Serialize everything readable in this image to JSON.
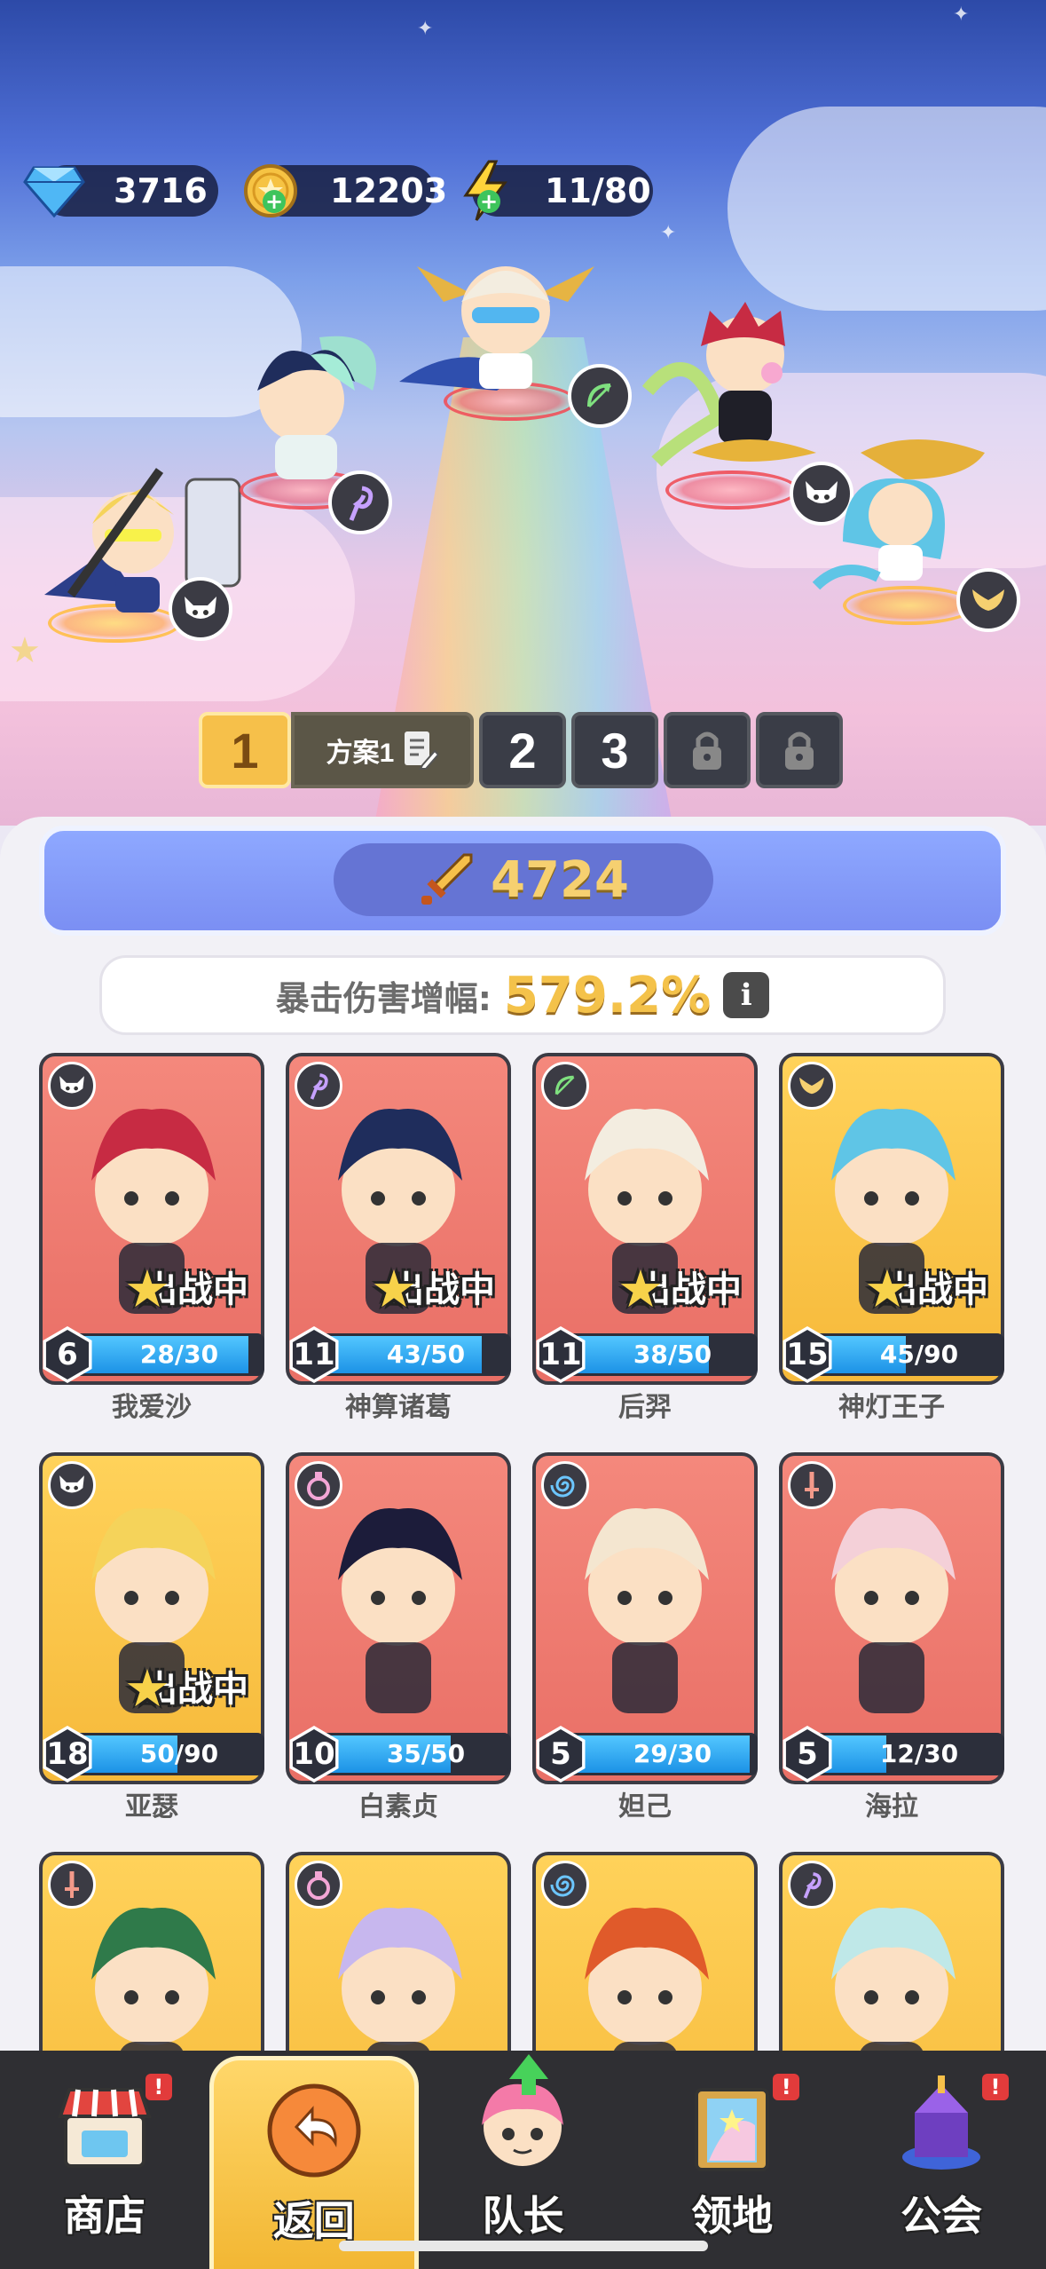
{
  "resources": {
    "diamonds": "3716",
    "gold": "12203",
    "energy": "11/80"
  },
  "formation": {
    "tabs": [
      "1",
      "2",
      "3"
    ],
    "active_tab": "1",
    "plan_label": "方案1"
  },
  "power": {
    "value": "4724"
  },
  "stat": {
    "label": "暴击伤害增幅:",
    "value": "579.2%",
    "info_glyph": "i"
  },
  "deploy_text": "出战中",
  "heroes": [
    {
      "name": "我爱沙",
      "level": "6",
      "exp": "28/30",
      "exp_fraction": 0.93,
      "deployed": true,
      "bg": "red",
      "class_icon": "demon-icon"
    },
    {
      "name": "神算诸葛",
      "level": "11",
      "exp": "43/50",
      "exp_fraction": 0.86,
      "deployed": true,
      "bg": "red",
      "class_icon": "staff-icon"
    },
    {
      "name": "后羿",
      "level": "11",
      "exp": "38/50",
      "exp_fraction": 0.76,
      "deployed": true,
      "bg": "red",
      "class_icon": "bow-icon"
    },
    {
      "name": "神灯王子",
      "level": "15",
      "exp": "45/90",
      "exp_fraction": 0.5,
      "deployed": true,
      "bg": "gold",
      "class_icon": "wings-icon"
    },
    {
      "name": "亚瑟",
      "level": "18",
      "exp": "50/90",
      "exp_fraction": 0.56,
      "deployed": true,
      "bg": "gold",
      "class_icon": "demon-icon"
    },
    {
      "name": "白素贞",
      "level": "10",
      "exp": "35/50",
      "exp_fraction": 0.7,
      "deployed": false,
      "bg": "red",
      "class_icon": "potion-icon"
    },
    {
      "name": "妲己",
      "level": "5",
      "exp": "29/30",
      "exp_fraction": 0.97,
      "deployed": false,
      "bg": "red",
      "class_icon": "swirl-icon"
    },
    {
      "name": "海拉",
      "level": "5",
      "exp": "12/30",
      "exp_fraction": 0.4,
      "deployed": false,
      "bg": "red",
      "class_icon": "sword-icon"
    },
    {
      "name": "",
      "level": "",
      "exp": "",
      "exp_fraction": 0,
      "deployed": false,
      "bg": "gold",
      "class_icon": "sword-icon"
    },
    {
      "name": "",
      "level": "",
      "exp": "",
      "exp_fraction": 0,
      "deployed": false,
      "bg": "gold",
      "class_icon": "potion-icon"
    },
    {
      "name": "",
      "level": "",
      "exp": "",
      "exp_fraction": 0,
      "deployed": false,
      "bg": "gold",
      "class_icon": "swirl-icon"
    },
    {
      "name": "",
      "level": "",
      "exp": "",
      "exp_fraction": 0,
      "deployed": false,
      "bg": "gold",
      "class_icon": "staff-icon"
    }
  ],
  "nav": [
    {
      "label": "商店",
      "icon": "shop-icon",
      "alert": "!",
      "active": false
    },
    {
      "label": "返回",
      "icon": "back-icon",
      "alert": "",
      "active": true
    },
    {
      "label": "队长",
      "icon": "captain-icon",
      "alert": "",
      "active": false,
      "upgrade": true
    },
    {
      "label": "领地",
      "icon": "territory-icon",
      "alert": "!",
      "active": false
    },
    {
      "label": "公会",
      "icon": "guild-icon",
      "alert": "!",
      "active": false
    }
  ],
  "colors": {
    "accent_gold": "#f6c04a",
    "panel_blue": "#7b8ff3",
    "card_red": "#e96f66",
    "card_gold": "#f6b93a",
    "exp_blue": "#1c92e6"
  }
}
